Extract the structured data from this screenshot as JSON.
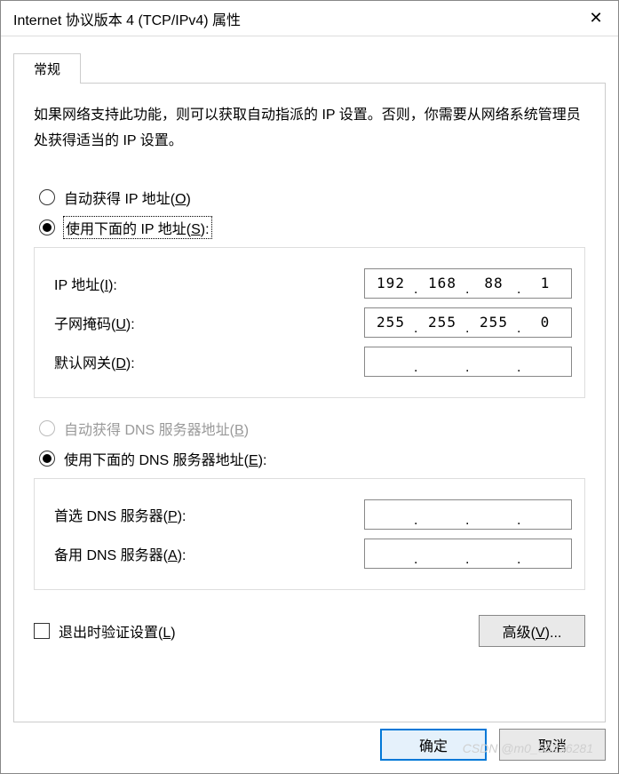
{
  "window": {
    "title": "Internet 协议版本 4 (TCP/IPv4) 属性",
    "close": "✕"
  },
  "tabs": {
    "general": "常规"
  },
  "description": "如果网络支持此功能，则可以获取自动指派的 IP 设置。否则，你需要从网络系统管理员处获得适当的 IP 设置。",
  "ip_section": {
    "radio_auto": {
      "label": "自动获得 IP 地址(",
      "key": "O",
      "tail": ")",
      "selected": false
    },
    "radio_manual": {
      "label": "使用下面的 IP 地址(",
      "key": "S",
      "tail": "):",
      "selected": true
    },
    "ip_label": {
      "label": "IP 地址(",
      "key": "I",
      "tail": "):"
    },
    "ip_value": [
      "192",
      "168",
      "88",
      "1"
    ],
    "mask_label": {
      "label": "子网掩码(",
      "key": "U",
      "tail": "):"
    },
    "mask_value": [
      "255",
      "255",
      "255",
      "0"
    ],
    "gateway_label": {
      "label": "默认网关(",
      "key": "D",
      "tail": "):"
    },
    "gateway_value": [
      "",
      "",
      "",
      ""
    ]
  },
  "dns_section": {
    "radio_auto": {
      "label": "自动获得 DNS 服务器地址(",
      "key": "B",
      "tail": ")",
      "disabled": true
    },
    "radio_manual": {
      "label": "使用下面的 DNS 服务器地址(",
      "key": "E",
      "tail": "):",
      "selected": true
    },
    "pref_label": {
      "label": "首选 DNS 服务器(",
      "key": "P",
      "tail": "):"
    },
    "pref_value": [
      "",
      "",
      "",
      ""
    ],
    "alt_label": {
      "label": "备用 DNS 服务器(",
      "key": "A",
      "tail": "):"
    },
    "alt_value": [
      "",
      "",
      "",
      ""
    ]
  },
  "validate_checkbox": {
    "label": "退出时验证设置(",
    "key": "L",
    "tail": ")",
    "checked": false
  },
  "buttons": {
    "advanced": {
      "label": "高级(",
      "key": "V",
      "tail": ")..."
    },
    "ok": "确定",
    "cancel": "取消"
  },
  "watermark": "CSDN @m0_55236281"
}
